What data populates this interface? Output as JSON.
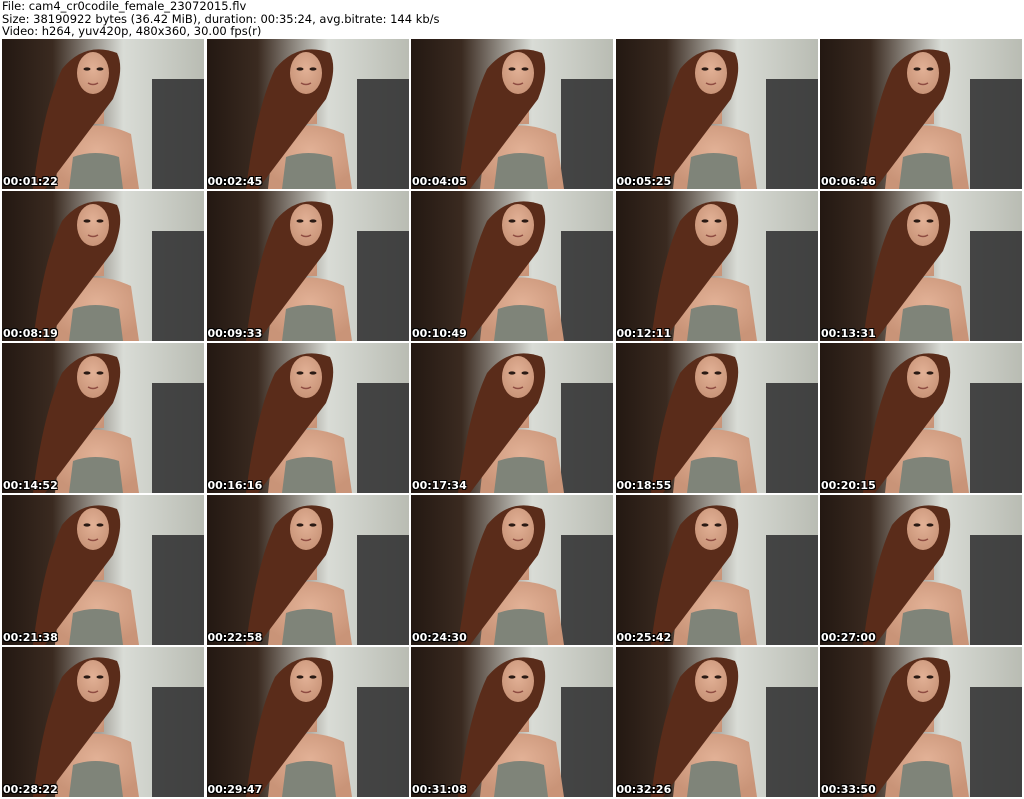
{
  "header": {
    "file_line": "File: cam4_cr0codile_female_23072015.flv",
    "size_line": "Size: 38190922 bytes (36.42 MiB), duration: 00:35:24, avg.bitrate: 144 kb/s",
    "video_line": "Video: h264, yuv420p, 480x360, 30.00 fps(r)"
  },
  "thumbnails": [
    {
      "timestamp": "00:01:22"
    },
    {
      "timestamp": "00:02:45"
    },
    {
      "timestamp": "00:04:05"
    },
    {
      "timestamp": "00:05:25"
    },
    {
      "timestamp": "00:06:46"
    },
    {
      "timestamp": "00:08:19"
    },
    {
      "timestamp": "00:09:33"
    },
    {
      "timestamp": "00:10:49"
    },
    {
      "timestamp": "00:12:11"
    },
    {
      "timestamp": "00:13:31"
    },
    {
      "timestamp": "00:14:52"
    },
    {
      "timestamp": "00:16:16"
    },
    {
      "timestamp": "00:17:34"
    },
    {
      "timestamp": "00:18:55"
    },
    {
      "timestamp": "00:20:15"
    },
    {
      "timestamp": "00:21:38"
    },
    {
      "timestamp": "00:22:58"
    },
    {
      "timestamp": "00:24:30"
    },
    {
      "timestamp": "00:25:42"
    },
    {
      "timestamp": "00:27:00"
    },
    {
      "timestamp": "00:28:22"
    },
    {
      "timestamp": "00:29:47"
    },
    {
      "timestamp": "00:31:08"
    },
    {
      "timestamp": "00:32:26"
    },
    {
      "timestamp": "00:33:50"
    }
  ],
  "colors": {
    "background": "#ffffff",
    "header_text": "#000000",
    "timestamp_text": "#ffffff",
    "timestamp_outline": "#000000",
    "room_dark": "#231812",
    "wall_light": "#d9dcd6",
    "skin": "#c99478",
    "hair": "#5a2c1a",
    "top_gray": "#7f8479"
  }
}
